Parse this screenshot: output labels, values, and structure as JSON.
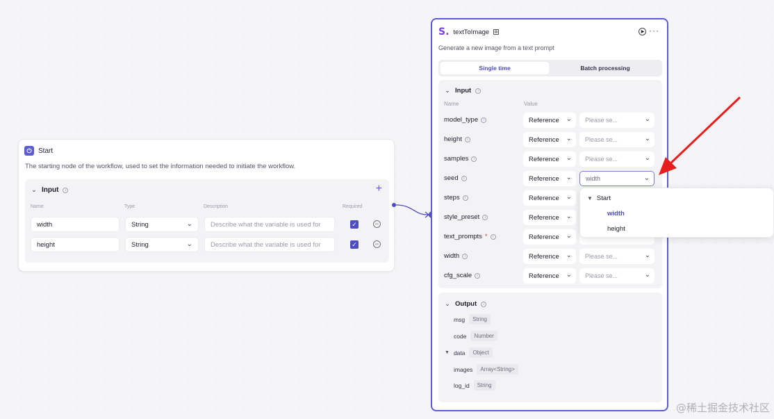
{
  "start_node": {
    "title": "Start",
    "description": "The starting node of the workflow, used to set the information needed to initiate the workflow.",
    "input_title": "Input",
    "columns": {
      "name": "Name",
      "type": "Type",
      "description": "Description",
      "required": "Required"
    },
    "rows": [
      {
        "name": "width",
        "type": "String",
        "description_placeholder": "Describe what the variable is used for",
        "required": true
      },
      {
        "name": "height",
        "type": "String",
        "description_placeholder": "Describe what the variable is used for",
        "required": true
      }
    ]
  },
  "tti_node": {
    "logo": "S.",
    "title": "textToImage",
    "description": "Generate a new image from a text prompt",
    "tabs": [
      "Single time",
      "Batch processing"
    ],
    "active_tab": "Single time",
    "input_title": "Input",
    "col_name": "Name",
    "col_value": "Value",
    "params": [
      {
        "name": "model_type",
        "mode": "Reference",
        "value": "Please se...",
        "required": false
      },
      {
        "name": "height",
        "mode": "Reference",
        "value": "Please se...",
        "required": false
      },
      {
        "name": "samples",
        "mode": "Reference",
        "value": "Please se...",
        "required": false
      },
      {
        "name": "seed",
        "mode": "Reference",
        "value": "width",
        "required": false
      },
      {
        "name": "steps",
        "mode": "Reference",
        "value": "",
        "required": false
      },
      {
        "name": "style_preset",
        "mode": "Reference",
        "value": "",
        "required": false
      },
      {
        "name": "text_prompts",
        "mode": "Reference",
        "value": "",
        "required": true
      },
      {
        "name": "width",
        "mode": "Reference",
        "value": "Please se...",
        "required": false
      },
      {
        "name": "cfg_scale",
        "mode": "Reference",
        "value": "Please se...",
        "required": false
      }
    ],
    "output_title": "Output",
    "outputs": [
      {
        "name": "msg",
        "type": "String"
      },
      {
        "name": "code",
        "type": "Number"
      },
      {
        "name": "data",
        "type": "Object"
      },
      {
        "name": "images",
        "type": "Array<String>"
      },
      {
        "name": "log_id",
        "type": "String"
      }
    ]
  },
  "dropdown": {
    "group": "Start",
    "items": [
      "width",
      "height"
    ],
    "selected": "width"
  },
  "colors": {
    "accent": "#5b5bd6",
    "arrow": "#e61e1e",
    "required": "#e0344a"
  },
  "watermark": "@稀土掘金技术社区"
}
